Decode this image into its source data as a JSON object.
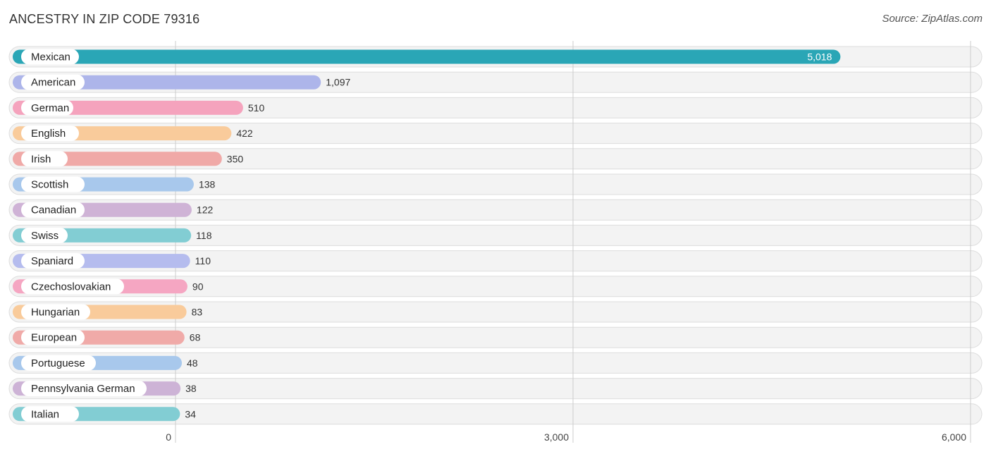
{
  "header": {
    "title": "ANCESTRY IN ZIP CODE 79316",
    "source": "Source: ZipAtlas.com"
  },
  "chart_data": {
    "type": "bar",
    "orientation": "horizontal",
    "title": "ANCESTRY IN ZIP CODE 79316",
    "xlabel": "",
    "ylabel": "",
    "xlim": [
      0,
      6000
    ],
    "ticks": [
      0,
      3000,
      6000
    ],
    "tick_labels": [
      "0",
      "3,000",
      "6,000"
    ],
    "grid": true,
    "categories": [
      "Mexican",
      "American",
      "German",
      "English",
      "Irish",
      "Scottish",
      "Canadian",
      "Swiss",
      "Spaniard",
      "Czechoslovakian",
      "Hungarian",
      "European",
      "Portuguese",
      "Pennsylvania German",
      "Italian"
    ],
    "values": [
      5018,
      1097,
      510,
      422,
      350,
      138,
      122,
      118,
      110,
      90,
      83,
      68,
      48,
      38,
      34
    ],
    "value_labels": [
      "5,018",
      "1,097",
      "510",
      "422",
      "350",
      "138",
      "122",
      "118",
      "110",
      "90",
      "83",
      "68",
      "48",
      "38",
      "34"
    ],
    "colors": [
      "#2aa6b6",
      "#adb5ea",
      "#f5a3bd",
      "#f9cb9b",
      "#f0a9a7",
      "#a8c8ec",
      "#cfb3d6",
      "#82cdd3",
      "#b5bcee",
      "#f5a6c2",
      "#f9cb9b",
      "#f0aaa8",
      "#a8c8ec",
      "#cdb3d6",
      "#82cdd3"
    ]
  }
}
